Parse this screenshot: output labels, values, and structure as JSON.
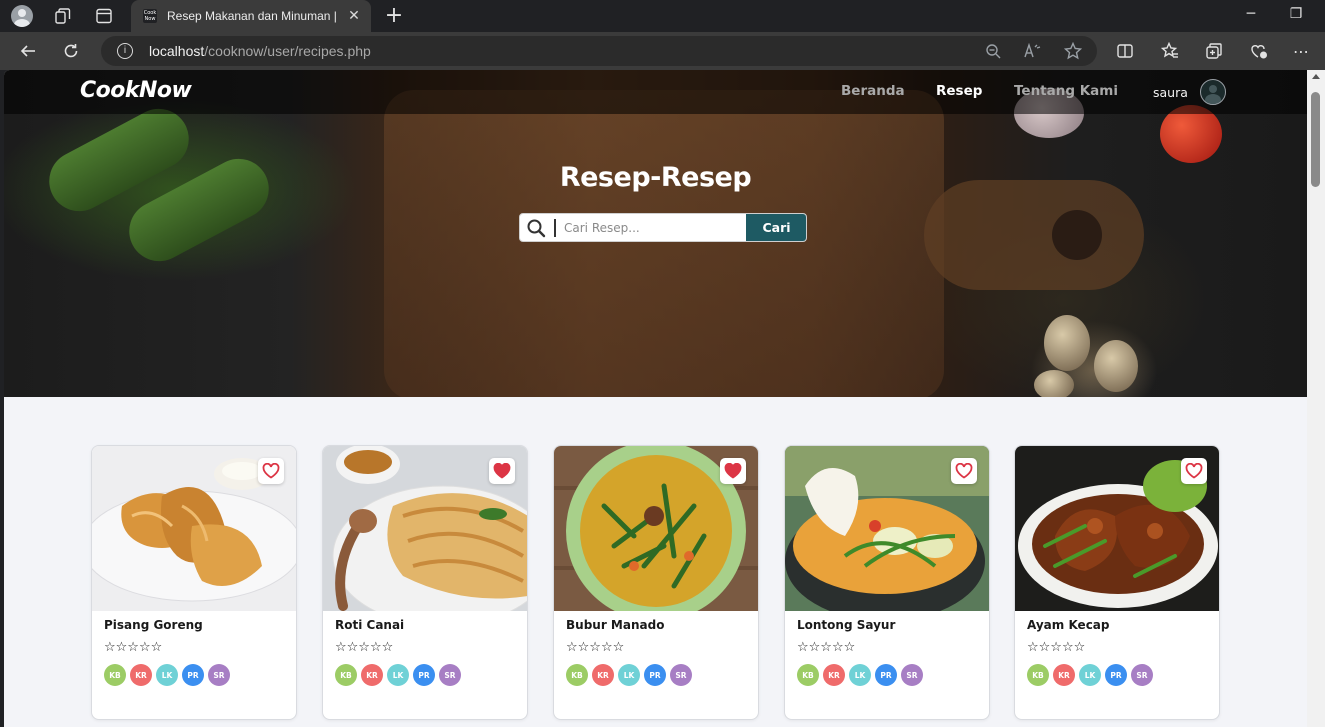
{
  "browser": {
    "tab_title": "Resep Makanan dan Minuman | CookNow",
    "favicon_text": "Cook Now",
    "url_host": "localhost",
    "url_path": "/cooknow/user/recipes.php"
  },
  "navbar": {
    "brand": "CookNow",
    "links": [
      {
        "label": "Beranda",
        "active": false
      },
      {
        "label": "Resep",
        "active": true
      },
      {
        "label": "Tentang Kami",
        "active": false
      }
    ],
    "username": "saura"
  },
  "hero": {
    "title": "Resep-Resep",
    "search_placeholder": "Cari Resep...",
    "search_button": "Cari"
  },
  "recipes": [
    {
      "title": "Pisang Goreng",
      "favorite": false,
      "rating": 0,
      "stars": "☆☆☆☆☆"
    },
    {
      "title": "Roti Canai",
      "favorite": true,
      "rating": 0,
      "stars": "☆☆☆☆☆"
    },
    {
      "title": "Bubur Manado",
      "favorite": true,
      "rating": 0,
      "stars": "☆☆☆☆☆"
    },
    {
      "title": "Lontong Sayur",
      "favorite": false,
      "rating": 0,
      "stars": "☆☆☆☆☆"
    },
    {
      "title": "Ayam Kecap",
      "favorite": false,
      "rating": 0,
      "stars": "☆☆☆☆☆"
    }
  ],
  "badges": [
    {
      "label": "KB",
      "color": "#9ccc65"
    },
    {
      "label": "KR",
      "color": "#ef6b6b"
    },
    {
      "label": "LK",
      "color": "#6fd1d6"
    },
    {
      "label": "PR",
      "color": "#3b8ff0"
    },
    {
      "label": "SR",
      "color": "#a77ec4"
    }
  ],
  "colors": {
    "accent": "#1e5a63",
    "heart": "#dc3545",
    "page_bg": "#f3f4f8"
  }
}
